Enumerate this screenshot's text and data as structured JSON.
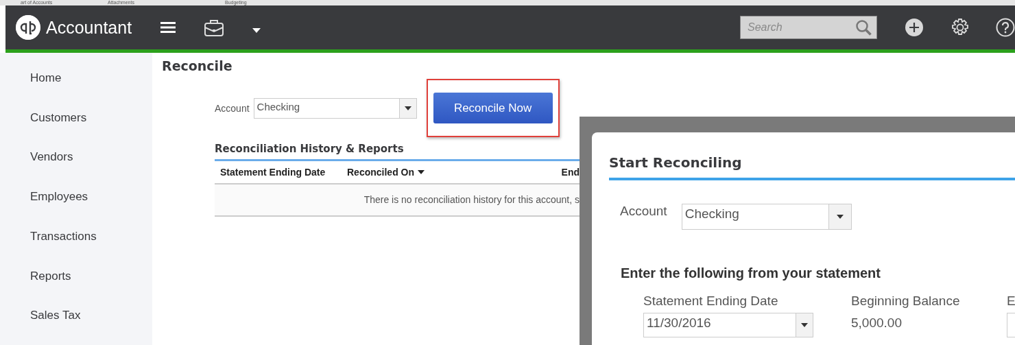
{
  "background_window": {
    "items": [
      "art of Accounts",
      "Attachments",
      "Budgeting"
    ]
  },
  "header": {
    "logo_text": "Accountant",
    "search": {
      "placeholder": "Search"
    }
  },
  "sidebar": {
    "items": [
      {
        "label": "Home"
      },
      {
        "label": "Customers"
      },
      {
        "label": "Vendors"
      },
      {
        "label": "Employees"
      },
      {
        "label": "Transactions"
      },
      {
        "label": "Reports"
      },
      {
        "label": "Sales Tax"
      }
    ]
  },
  "page": {
    "title": "Reconcile",
    "account": {
      "label": "Account",
      "value": "Checking"
    },
    "button": "Reconcile Now",
    "history": {
      "title": "Reconciliation History & Reports",
      "columns": [
        {
          "label": "Statement Ending Date",
          "sorted": false
        },
        {
          "label": "Reconciled On",
          "sorted": true
        },
        {
          "label": "End",
          "sorted": false
        }
      ],
      "empty_message": "There is no reconciliation history for this account, s"
    }
  },
  "dialog": {
    "title": "Start Reconciling",
    "account": {
      "label": "Account",
      "value": "Checking"
    },
    "section_title": "Enter the following from your statement",
    "fields": [
      {
        "kind": "date",
        "label": "Statement Ending Date",
        "value": "11/30/2016"
      },
      {
        "kind": "text",
        "label": "Beginning Balance",
        "value": "5,000.00"
      },
      {
        "kind": "input",
        "label": "E"
      }
    ]
  }
}
